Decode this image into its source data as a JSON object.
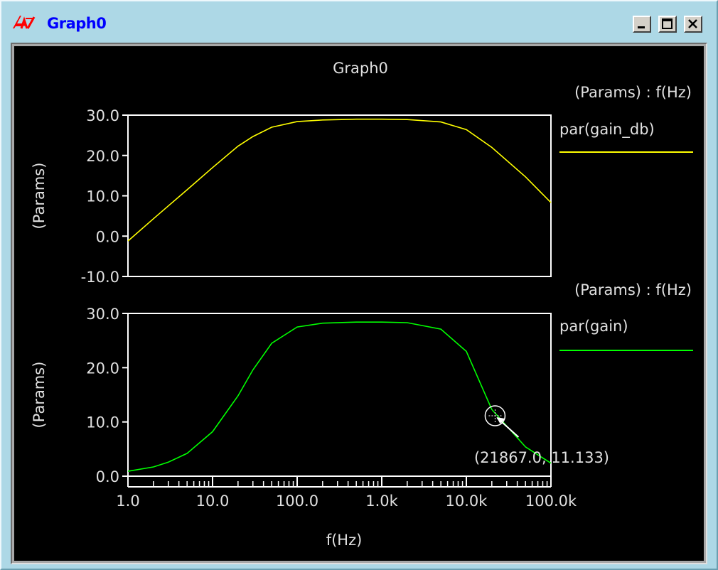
{
  "window": {
    "title": "Graph0",
    "icon": "dna-app-icon",
    "buttons": {
      "minimize": "minimize-icon",
      "maximize": "maximize-icon",
      "close": "close-icon"
    }
  },
  "graph_title": "Graph0",
  "colors": {
    "background": "#000000",
    "frame": "#ffffff",
    "text": "#e0e0e0",
    "trace_gain_db": "#ffff00",
    "trace_gain": "#00ff00"
  },
  "chart_data": [
    {
      "type": "line",
      "title": "",
      "xlabel": "",
      "ylabel": "(Params)",
      "x_scale": "log",
      "xlim": [
        1,
        100000
      ],
      "ylim": [
        -10,
        30
      ],
      "yticks": [
        "30.0",
        "20.0",
        "10.0",
        "0.0",
        "-10.0"
      ],
      "legend_header": "(Params) : f(Hz)",
      "legend_position": "right",
      "series": [
        {
          "name": "par(gain_db)",
          "color": "#ffff00",
          "x": [
            1,
            2,
            3,
            5,
            10,
            20,
            30,
            50,
            100,
            200,
            500,
            1000,
            2000,
            5000,
            10000,
            20000,
            50000,
            100000
          ],
          "y": [
            -1.2,
            4.3,
            7.5,
            11.5,
            17.0,
            22.3,
            24.7,
            27.0,
            28.4,
            28.8,
            29.0,
            29.0,
            28.9,
            28.3,
            26.4,
            22.0,
            14.7,
            8.3
          ]
        }
      ]
    },
    {
      "type": "line",
      "title": "",
      "xlabel": "f(Hz)",
      "ylabel": "(Params)",
      "x_scale": "log",
      "xlim": [
        1,
        100000
      ],
      "ylim": [
        0,
        30
      ],
      "yticks": [
        "30.0",
        "20.0",
        "10.0",
        "0.0"
      ],
      "xticks": [
        "1.0",
        "10.0",
        "100.0",
        "1.0k",
        "10.0k",
        "100.0k"
      ],
      "legend_header": "(Params) : f(Hz)",
      "legend_position": "right",
      "series": [
        {
          "name": "par(gain)",
          "color": "#00ff00",
          "x": [
            1,
            2,
            3,
            5,
            10,
            20,
            30,
            50,
            100,
            200,
            500,
            1000,
            2000,
            5000,
            10000,
            20000,
            50000,
            100000
          ],
          "y": [
            0.9,
            1.7,
            2.6,
            4.2,
            8.2,
            14.8,
            19.6,
            24.5,
            27.5,
            28.2,
            28.4,
            28.4,
            28.3,
            27.1,
            23.0,
            12.3,
            5.4,
            2.4
          ]
        }
      ],
      "marker": {
        "x": 21867.0,
        "y": 11.133,
        "label": "(21867.0, 11.133)"
      }
    }
  ]
}
